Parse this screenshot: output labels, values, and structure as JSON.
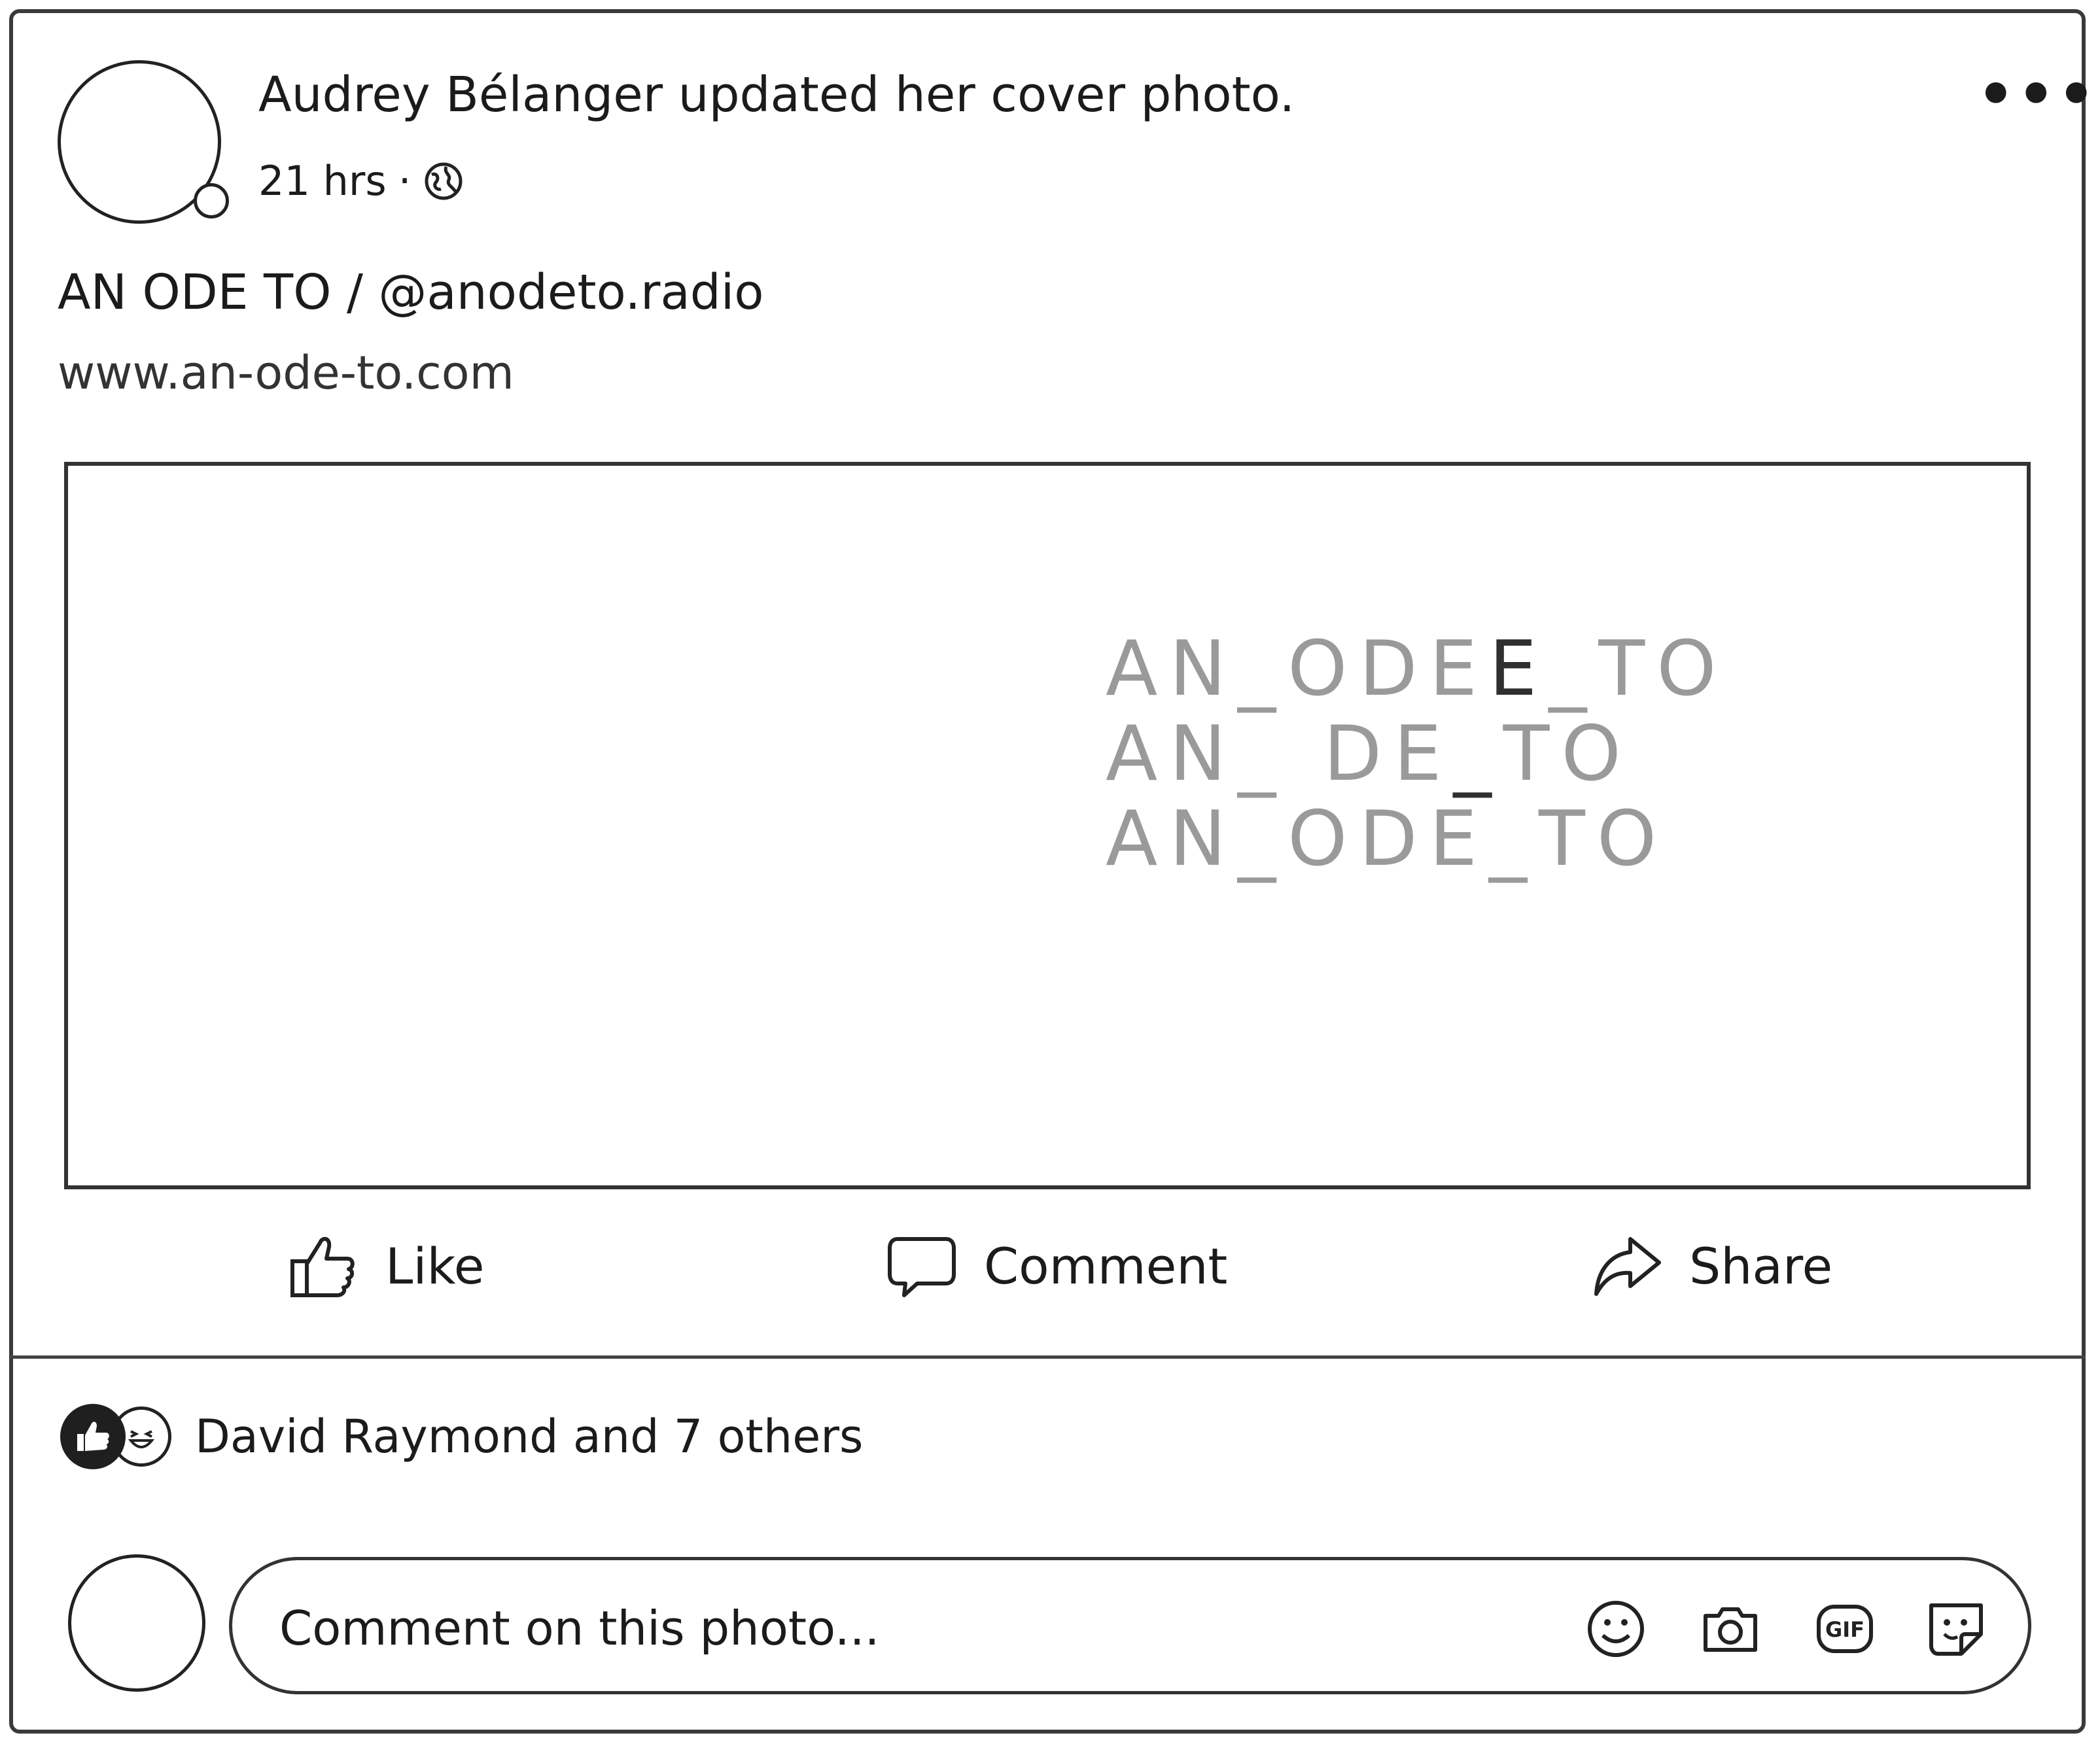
{
  "post": {
    "author": "Audrey Bélanger",
    "headline": "Audrey Bélanger updated her cover photo.",
    "time": "21 hrs",
    "separator": "·",
    "privacy_icon": "globe-icon",
    "more_label": "•••",
    "description_line1": "AN ODE TO / @anodeto.radio",
    "description_line2": "www.an-ode-to.com"
  },
  "cover_photo": {
    "lines": [
      {
        "pre": "AN_ODE",
        "mid": "E",
        "post": "_TO"
      },
      {
        "pre": "AN_ DE",
        "mid": "_",
        "post": "TO"
      },
      {
        "pre": "AN_ODE_TO",
        "mid": "",
        "post": ""
      }
    ]
  },
  "actions": {
    "like": "Like",
    "comment": "Comment",
    "share": "Share"
  },
  "reactions": {
    "icons": [
      "like-icon",
      "haha-icon"
    ],
    "summary": "David Raymond and 7 others"
  },
  "comment_composer": {
    "placeholder": "Comment on this photo...",
    "buttons": [
      "emoji-icon",
      "camera-icon",
      "gif-icon",
      "sticker-icon"
    ],
    "gif_label": "GIF"
  }
}
